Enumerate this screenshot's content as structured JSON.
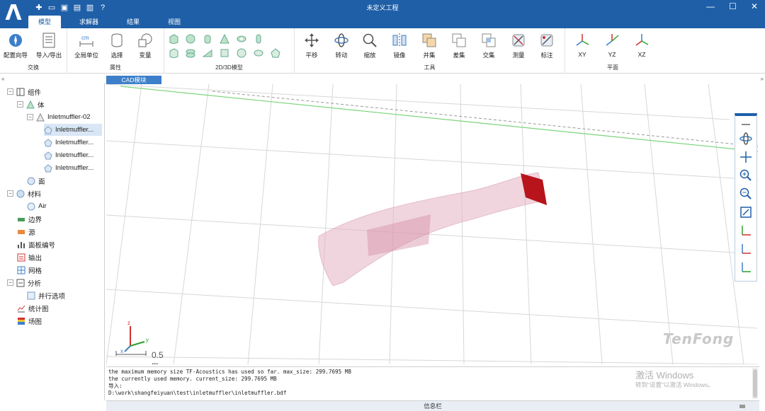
{
  "app": {
    "title": "未定义工程"
  },
  "tabs": [
    {
      "label": "模型"
    },
    {
      "label": "求解器"
    },
    {
      "label": "结果"
    },
    {
      "label": "视图"
    }
  ],
  "window_controls": {
    "minimize": "—",
    "maximize": "☐",
    "close": "✕"
  },
  "ribbon": {
    "groups": {
      "exchange": "交换",
      "properties": "属性",
      "geometry": "2D/3D模型",
      "tools": "工具",
      "plane": "平面"
    },
    "buttons": {
      "config_wizard": "配置向导",
      "import_export": "导入/导出",
      "global_unit": "全局单位",
      "select": "选择",
      "variable": "变量",
      "pan": "平移",
      "rotate": "转动",
      "zoom": "缩放",
      "mirror": "镜像",
      "union": "并集",
      "difference": "差集",
      "intersection": "交集",
      "measure": "测量",
      "annotate": "标注",
      "xy": "XY",
      "yz": "YZ",
      "xz": "XZ"
    },
    "unit_icon_text": "cm"
  },
  "tree": {
    "components": "组件",
    "body": "体",
    "body_item": "Inletmuffler-02",
    "parts": [
      "Inletmuffler...",
      "Inletmuffler...",
      "Inletmuffler...",
      "Inletmuffler..."
    ],
    "face": "面",
    "material": "材料",
    "air": "Air",
    "boundary": "边界",
    "source": "源",
    "panel_numbering": "面板编号",
    "output": "输出",
    "mesh": "网格",
    "analysis": "分析",
    "parallel_options": "并行选项",
    "statistics": "统计图",
    "field_map": "场图"
  },
  "viewport": {
    "tab_label": "CAD模块",
    "scale_label": "0.5 m",
    "brand": "TenFong",
    "axes": {
      "x": "x",
      "y": "y",
      "z": "z"
    }
  },
  "console": {
    "lines": [
      "the maximum memory size TF-Acoustics has used so far. max_size: 299.7695 MB",
      "the currently used memory. current_size: 299.7695 MB",
      "导入:",
      "D:\\work\\shangfeiyuan\\test\\inletmuffler\\inletmuffler.bdf"
    ]
  },
  "watermark": {
    "title": "激活 Windows",
    "subtitle": "转到\"设置\"以激活 Windows。"
  },
  "infobar": {
    "label": "信息栏"
  },
  "colors": {
    "brand": "#1f5fa8",
    "accent": "#3d7fc9",
    "face_red": "#b8141b",
    "body_pink": "#e3b3c3",
    "green_line": "#7bd47b"
  }
}
